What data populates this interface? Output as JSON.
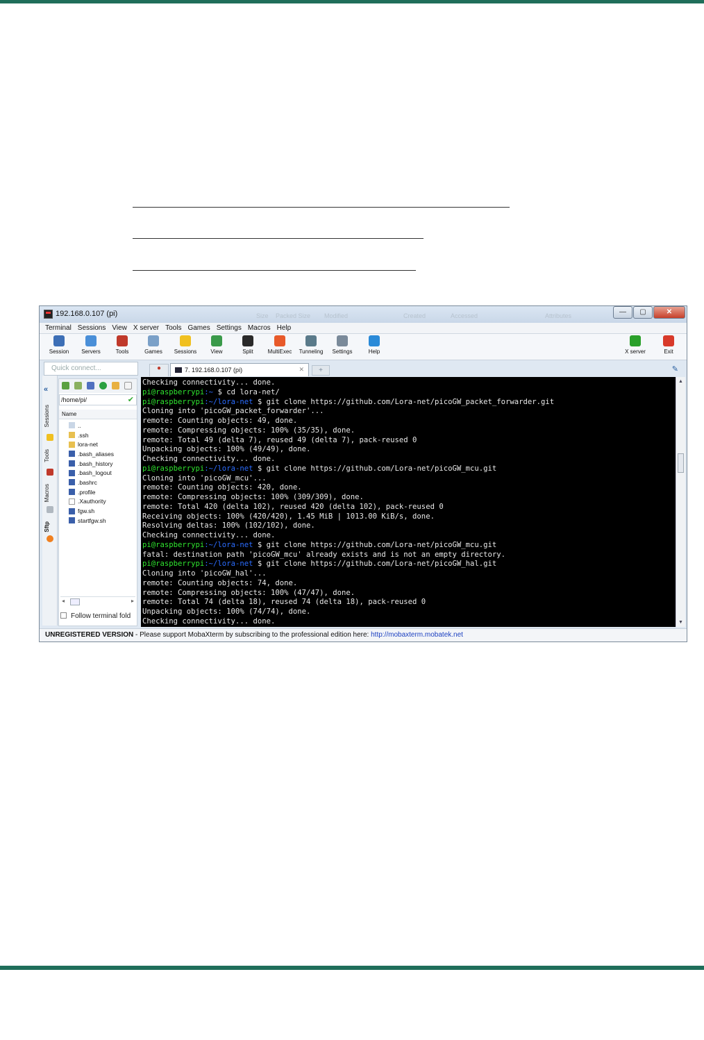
{
  "document": {
    "top_rule_color": "#1f6e5a",
    "bottom_rule_color": "#1f6e5a"
  },
  "window": {
    "title": "192.168.0.107 (pi)",
    "ghost_headers": [
      "Size",
      "Packed Size",
      "Modified",
      "Created",
      "Accessed",
      "Attributes"
    ],
    "buttons": {
      "minimize": "—",
      "maximize": "▢",
      "close": "✕"
    }
  },
  "menu": [
    "Terminal",
    "Sessions",
    "View",
    "X server",
    "Tools",
    "Games",
    "Settings",
    "Macros",
    "Help"
  ],
  "toolbar": [
    {
      "label": "Session",
      "icon": "session-icon",
      "color": "#3d6fb6"
    },
    {
      "label": "Servers",
      "icon": "servers-icon",
      "color": "#4a8fd8"
    },
    {
      "label": "Tools",
      "icon": "tools-icon",
      "color": "#c0392b"
    },
    {
      "label": "Games",
      "icon": "games-icon",
      "color": "#7aa0c8"
    },
    {
      "label": "Sessions",
      "icon": "star-icon",
      "color": "#f0c020"
    },
    {
      "label": "View",
      "icon": "view-icon",
      "color": "#3a9a4a"
    },
    {
      "label": "Split",
      "icon": "split-icon",
      "color": "#2a2a2a"
    },
    {
      "label": "MultiExec",
      "icon": "multiexec-icon",
      "color": "#e85a2a"
    },
    {
      "label": "Tunneling",
      "icon": "tunneling-icon",
      "color": "#5a7a8a"
    },
    {
      "label": "Settings",
      "icon": "settings-icon",
      "color": "#7a8a9a"
    },
    {
      "label": "Help",
      "icon": "help-icon",
      "color": "#2a8ad8"
    },
    {
      "label": "X server",
      "icon": "x-server-icon",
      "color": "#2aa02a"
    },
    {
      "label": "Exit",
      "icon": "exit-icon",
      "color": "#d83a2a"
    }
  ],
  "quick_connect": {
    "placeholder": "Quick connect..."
  },
  "tabs": {
    "active": "7. 192.168.0.107 (pi)",
    "close": "✕",
    "new": "+"
  },
  "side_tabs": [
    "Sessions",
    "Tools",
    "Macros",
    "Sftp"
  ],
  "sftp": {
    "path": "/home/pi/",
    "column": "Name",
    "files": [
      {
        "name": "..",
        "type": "up"
      },
      {
        "name": ".ssh",
        "type": "dir"
      },
      {
        "name": "lora-net",
        "type": "dir"
      },
      {
        "name": ".bash_aliases",
        "type": "file"
      },
      {
        "name": ".bash_history",
        "type": "file"
      },
      {
        "name": ".bash_logout",
        "type": "file"
      },
      {
        "name": ".bashrc",
        "type": "file"
      },
      {
        "name": ".profile",
        "type": "file"
      },
      {
        "name": ".Xauthority",
        "type": "blank"
      },
      {
        "name": "fgw.sh",
        "type": "file"
      },
      {
        "name": "startfgw.sh",
        "type": "file"
      }
    ],
    "follow_label": "Follow terminal fold"
  },
  "terminal": {
    "lines": [
      {
        "text": "Checking connectivity... done."
      },
      {
        "prompt": "pi@raspberrypi",
        "dir": ":~",
        "cmd": " $ cd lora-net/"
      },
      {
        "prompt": "pi@raspberrypi",
        "dir": ":~/lora-net",
        "cmd": " $ git clone https://github.com/Lora-net/picoGW_packet_forwarder.git"
      },
      {
        "text": "Cloning into 'picoGW_packet_forwarder'..."
      },
      {
        "text": "remote: Counting objects: 49, done."
      },
      {
        "text": "remote: Compressing objects: 100% (35/35), done."
      },
      {
        "text": "remote: Total 49 (delta 7), reused 49 (delta 7), pack-reused 0"
      },
      {
        "text": "Unpacking objects: 100% (49/49), done."
      },
      {
        "text": "Checking connectivity... done."
      },
      {
        "prompt": "pi@raspberrypi",
        "dir": ":~/lora-net",
        "cmd": " $ git clone https://github.com/Lora-net/picoGW_mcu.git"
      },
      {
        "text": "Cloning into 'picoGW_mcu'..."
      },
      {
        "text": "remote: Counting objects: 420, done."
      },
      {
        "text": "remote: Compressing objects: 100% (309/309), done."
      },
      {
        "text": "remote: Total 420 (delta 102), reused 420 (delta 102), pack-reused 0"
      },
      {
        "text": "Receiving objects: 100% (420/420), 1.45 MiB | 1013.00 KiB/s, done."
      },
      {
        "text": "Resolving deltas: 100% (102/102), done."
      },
      {
        "text": "Checking connectivity... done."
      },
      {
        "prompt": "pi@raspberrypi",
        "dir": ":~/lora-net",
        "cmd": " $ git clone https://github.com/Lora-net/picoGW_mcu.git"
      },
      {
        "text": "fatal: destination path 'picoGW_mcu' already exists and is not an empty directory."
      },
      {
        "prompt": "pi@raspberrypi",
        "dir": ":~/lora-net",
        "cmd": " $ git clone https://github.com/Lora-net/picoGW_hal.git"
      },
      {
        "text": "Cloning into 'picoGW_hal'..."
      },
      {
        "text": "remote: Counting objects: 74, done."
      },
      {
        "text": "remote: Compressing objects: 100% (47/47), done."
      },
      {
        "text": "remote: Total 74 (delta 18), reused 74 (delta 18), pack-reused 0"
      },
      {
        "text": "Unpacking objects: 100% (74/74), done."
      },
      {
        "text": "Checking connectivity... done."
      }
    ]
  },
  "status": {
    "edition": "UNREGISTERED VERSION",
    "message": " -  Please support MobaXterm by subscribing to the professional edition here:  ",
    "link": "http://mobaxterm.mobatek.net"
  }
}
